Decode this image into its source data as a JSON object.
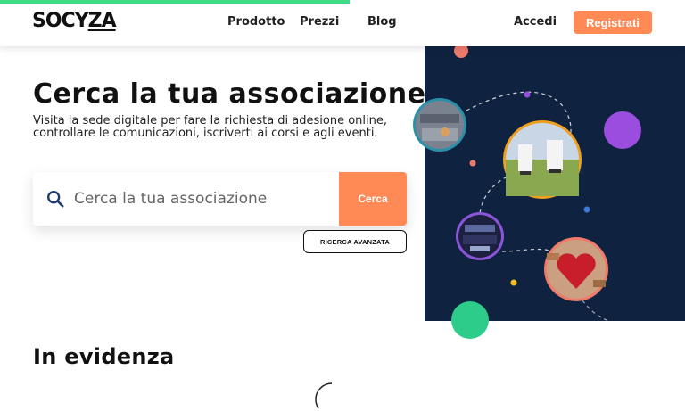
{
  "header": {
    "logo_text_a": "SOCY",
    "logo_text_b": "ZA",
    "nav": [
      "Prodotto",
      "Prezzi",
      "Blog"
    ],
    "login_label": "Accedi",
    "register_label": "Registrati"
  },
  "hero": {
    "title": "Cerca la tua associazione",
    "subtitle": "Visita la sede digitale per fare la richiesta di adesione online, controllare le comunicazioni, iscriverti ai corsi e agli eventi."
  },
  "search": {
    "placeholder": "Cerca la tua associazione",
    "button_label": "Cerca",
    "advanced_label": "RICERCA AVANZATA"
  },
  "sections": {
    "featured_title": "In evidenza"
  },
  "colors": {
    "accent": "#ff8a56",
    "progress": "#3ddc84",
    "illustration_bg": "#0f2340",
    "purple": "#9b4de0",
    "green": "#2ecc8a",
    "salmon": "#ef7a6a"
  },
  "icons": {
    "search": "search-icon",
    "loader": "loading-spinner-icon"
  }
}
